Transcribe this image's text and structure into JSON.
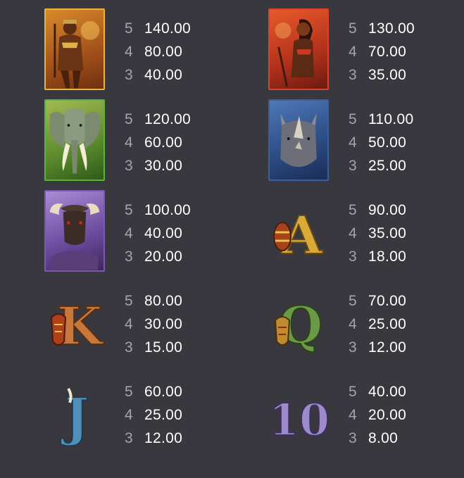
{
  "symbols": [
    {
      "name": "hunter",
      "pays": [
        {
          "count": "5",
          "amount": "140.00"
        },
        {
          "count": "4",
          "amount": "80.00"
        },
        {
          "count": "3",
          "amount": "40.00"
        }
      ]
    },
    {
      "name": "warrior-woman",
      "pays": [
        {
          "count": "5",
          "amount": "130.00"
        },
        {
          "count": "4",
          "amount": "70.00"
        },
        {
          "count": "3",
          "amount": "35.00"
        }
      ]
    },
    {
      "name": "elephant",
      "pays": [
        {
          "count": "5",
          "amount": "120.00"
        },
        {
          "count": "4",
          "amount": "60.00"
        },
        {
          "count": "3",
          "amount": "30.00"
        }
      ]
    },
    {
      "name": "rhino",
      "pays": [
        {
          "count": "5",
          "amount": "110.00"
        },
        {
          "count": "4",
          "amount": "50.00"
        },
        {
          "count": "3",
          "amount": "25.00"
        }
      ]
    },
    {
      "name": "buffalo",
      "pays": [
        {
          "count": "5",
          "amount": "100.00"
        },
        {
          "count": "4",
          "amount": "40.00"
        },
        {
          "count": "3",
          "amount": "20.00"
        }
      ]
    },
    {
      "name": "letter-a",
      "letter": "A",
      "pays": [
        {
          "count": "5",
          "amount": "90.00"
        },
        {
          "count": "4",
          "amount": "35.00"
        },
        {
          "count": "3",
          "amount": "18.00"
        }
      ]
    },
    {
      "name": "letter-k",
      "letter": "K",
      "pays": [
        {
          "count": "5",
          "amount": "80.00"
        },
        {
          "count": "4",
          "amount": "30.00"
        },
        {
          "count": "3",
          "amount": "15.00"
        }
      ]
    },
    {
      "name": "letter-q",
      "letter": "Q",
      "pays": [
        {
          "count": "5",
          "amount": "70.00"
        },
        {
          "count": "4",
          "amount": "25.00"
        },
        {
          "count": "3",
          "amount": "12.00"
        }
      ]
    },
    {
      "name": "letter-j",
      "letter": "J",
      "pays": [
        {
          "count": "5",
          "amount": "60.00"
        },
        {
          "count": "4",
          "amount": "25.00"
        },
        {
          "count": "3",
          "amount": "12.00"
        }
      ]
    },
    {
      "name": "number-10",
      "letter": "10",
      "pays": [
        {
          "count": "5",
          "amount": "40.00"
        },
        {
          "count": "4",
          "amount": "20.00"
        },
        {
          "count": "3",
          "amount": "8.00"
        }
      ]
    }
  ],
  "colors": {
    "background": "#38383e",
    "amount": "#ffffff",
    "count": "#a4a4aa",
    "letter_gold": "#d9a93a"
  }
}
